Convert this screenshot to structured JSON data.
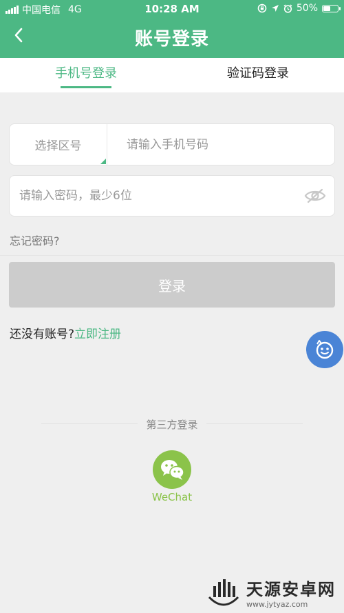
{
  "status_bar": {
    "carrier": "中国电信",
    "network": "4G",
    "time": "10:28 AM",
    "battery": "50%",
    "battery_level": 0.5
  },
  "nav": {
    "title": "账号登录"
  },
  "tabs": [
    {
      "label": "手机号登录",
      "active": true
    },
    {
      "label": "验证码登录",
      "active": false
    }
  ],
  "form": {
    "region_label": "选择区号",
    "phone_placeholder": "请输入手机号码",
    "password_placeholder": "请输入密码，最少6位",
    "forgot_label": "忘记密码?",
    "login_label": "登录",
    "no_account_label": "还没有账号?",
    "register_label": "立即注册"
  },
  "third_party": {
    "title": "第三方登录",
    "wechat_label": "WeChat"
  },
  "watermark": {
    "title": "天源安卓网",
    "url": "www.jytyaz.com"
  },
  "colors": {
    "brand_green": "#4cb884",
    "wechat_green": "#8bc34a",
    "float_blue": "#4a84d6",
    "disabled_gray": "#cccccc"
  }
}
